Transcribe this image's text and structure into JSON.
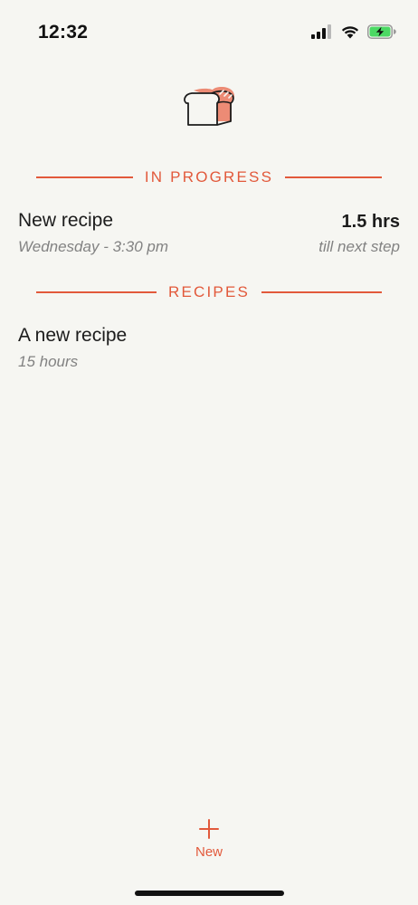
{
  "status_bar": {
    "time": "12:32",
    "icons": [
      "cellular-signal-icon",
      "wifi-icon",
      "battery-charging-icon"
    ],
    "battery_color": "#4cd964"
  },
  "app": {
    "logo": "bread-loaf-icon",
    "accent_color": "#e2593b"
  },
  "in_progress": {
    "header": "IN PROGRESS",
    "items": [
      {
        "name": "New recipe",
        "schedule": "Wednesday - 3:30 pm",
        "time_remaining": "1.5 hrs",
        "time_remaining_caption": "till next step"
      }
    ]
  },
  "recipes": {
    "header": "RECIPES",
    "items": [
      {
        "name": "A new recipe",
        "duration": "15 hours"
      }
    ]
  },
  "bottom_bar": {
    "new_icon": "plus-icon",
    "new_label": "New"
  }
}
